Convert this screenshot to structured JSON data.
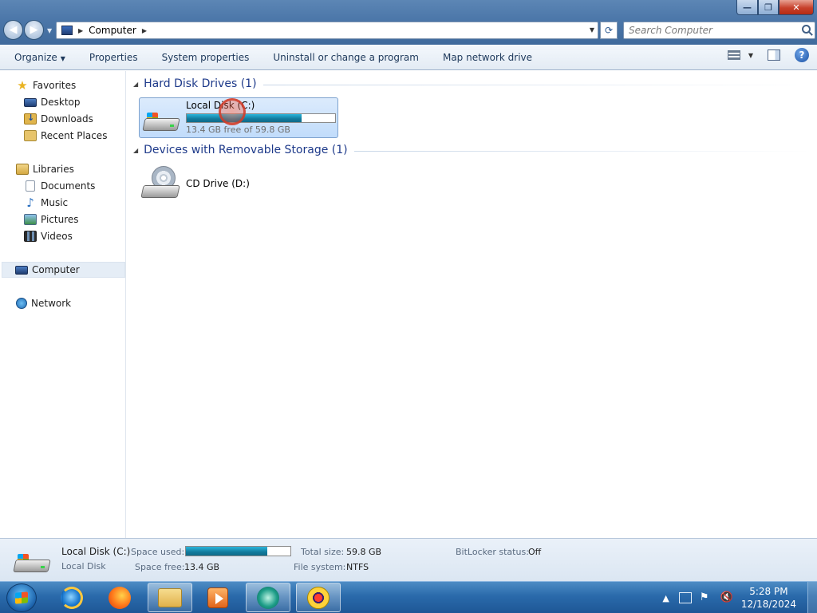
{
  "window": {
    "minimize_glyph": "—",
    "maximize_glyph": "❐",
    "close_glyph": "✕"
  },
  "address": {
    "crumbs": [
      "Computer"
    ]
  },
  "search": {
    "placeholder": "Search Computer"
  },
  "toolbar": {
    "organize": "Organize",
    "properties": "Properties",
    "system_properties": "System properties",
    "uninstall": "Uninstall or change a program",
    "map_drive": "Map network drive"
  },
  "nav": {
    "favorites": "Favorites",
    "desktop": "Desktop",
    "downloads": "Downloads",
    "recent_places": "Recent Places",
    "libraries": "Libraries",
    "documents": "Documents",
    "music": "Music",
    "pictures": "Pictures",
    "videos": "Videos",
    "computer": "Computer",
    "network": "Network"
  },
  "groups": {
    "hdd": {
      "title": "Hard Disk Drives",
      "count": "(1)"
    },
    "removable": {
      "title": "Devices with Removable Storage",
      "count": "(1)"
    }
  },
  "drives": {
    "c": {
      "name": "Local Disk (C:)",
      "free_text": "13.4 GB free of 59.8 GB",
      "used_fraction": 0.776
    },
    "d": {
      "name": "CD Drive (D:)"
    }
  },
  "details": {
    "name": "Local Disk (C:)",
    "type": "Local Disk",
    "space_used_label": "Space used:",
    "space_free_label": "Space free:",
    "space_free": "13.4 GB",
    "total_size_label": "Total size:",
    "total_size": "59.8 GB",
    "file_system_label": "File system:",
    "file_system": "NTFS",
    "bitlocker_label": "BitLocker status:",
    "bitlocker": "Off"
  },
  "taskbar": {
    "time": "5:28 PM",
    "date": "12/18/2024",
    "tray_arrow": "▲"
  },
  "colors": {
    "group_title": "#1e3a8a",
    "bar_fill": "#1a93b8",
    "selection": "#c1dcfb"
  }
}
